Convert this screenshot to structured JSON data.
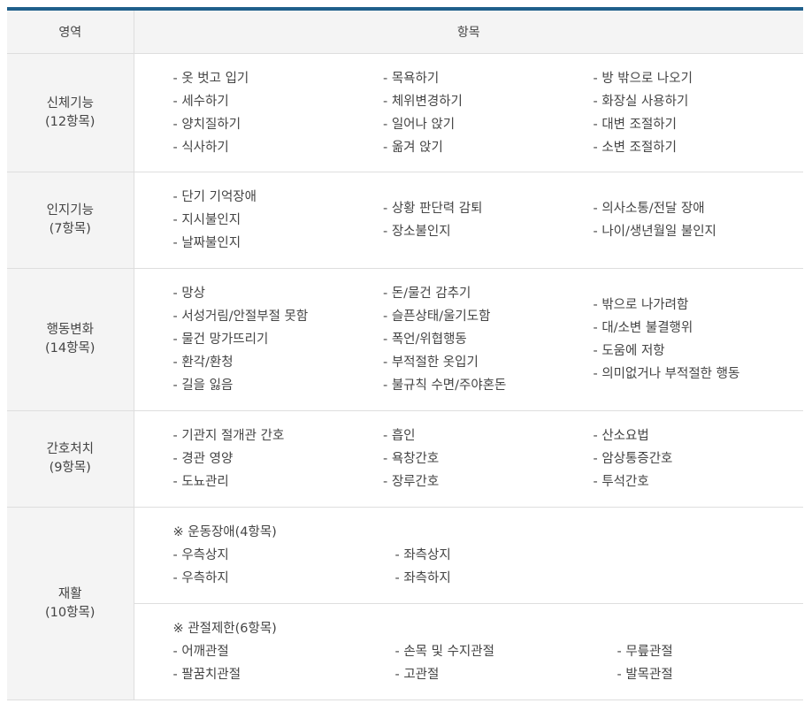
{
  "header": {
    "area": "영역",
    "items": "항목"
  },
  "rows": [
    {
      "area": "신체기능",
      "count": "(12항목)",
      "columns": [
        [
          "- 옷 벗고 입기",
          "- 세수하기",
          "- 양치질하기",
          "- 식사하기"
        ],
        [
          "- 목욕하기",
          "- 체위변경하기",
          "- 일어나 앉기",
          "- 옮겨 앉기"
        ],
        [
          "- 방 밖으로 나오기",
          "- 화장실 사용하기",
          "- 대변 조절하기",
          "- 소변 조절하기"
        ]
      ]
    },
    {
      "area": "인지기능",
      "count": "(7항목)",
      "columns": [
        [
          "- 단기 기억장애",
          "- 지시불인지",
          "- 날짜불인지"
        ],
        [
          "- 상황 판단력 감퇴",
          "- 장소불인지"
        ],
        [
          "- 의사소통/전달 장애",
          "- 나이/생년월일 불인지"
        ]
      ]
    },
    {
      "area": "행동변화",
      "count": "(14항목)",
      "columns": [
        [
          "- 망상",
          "- 서성거림/안절부절 못함",
          "- 물건 망가뜨리기",
          "- 환각/환청",
          "- 길을 잃음"
        ],
        [
          "- 돈/물건 감추기",
          "- 슬픈상태/울기도함",
          "- 폭언/위협행동",
          "- 부적절한 옷입기",
          "- 불규칙 수면/주야혼돈"
        ],
        [
          "- 밖으로 나가려함",
          "- 대/소변 불결행위",
          "- 도움에 저항",
          "- 의미없거나 부적절한 행동"
        ]
      ]
    },
    {
      "area": "간호처치",
      "count": "(9항목)",
      "columns": [
        [
          "- 기관지 절개관 간호",
          "- 경관 영양",
          "- 도뇨관리"
        ],
        [
          "- 흡인",
          "- 욕창간호",
          "- 장루간호"
        ],
        [
          "- 산소요법",
          "- 암상통증간호",
          "- 투석간호"
        ]
      ]
    }
  ],
  "rehab": {
    "area": "재활",
    "count": "(10항목)",
    "motor": {
      "heading": "※ 운동장애(4항목)",
      "columns": [
        [
          "- 우측상지",
          "- 우측하지"
        ],
        [
          "- 좌측상지",
          "- 좌측하지"
        ]
      ]
    },
    "joint": {
      "heading": "※ 관절제한(6항목)",
      "columns": [
        [
          "- 어깨관절",
          "- 팔꿈치관절"
        ],
        [
          "- 손목 및 수지관절",
          "- 고관절"
        ],
        [
          "- 무릎관절",
          "- 발목관절"
        ]
      ]
    }
  }
}
